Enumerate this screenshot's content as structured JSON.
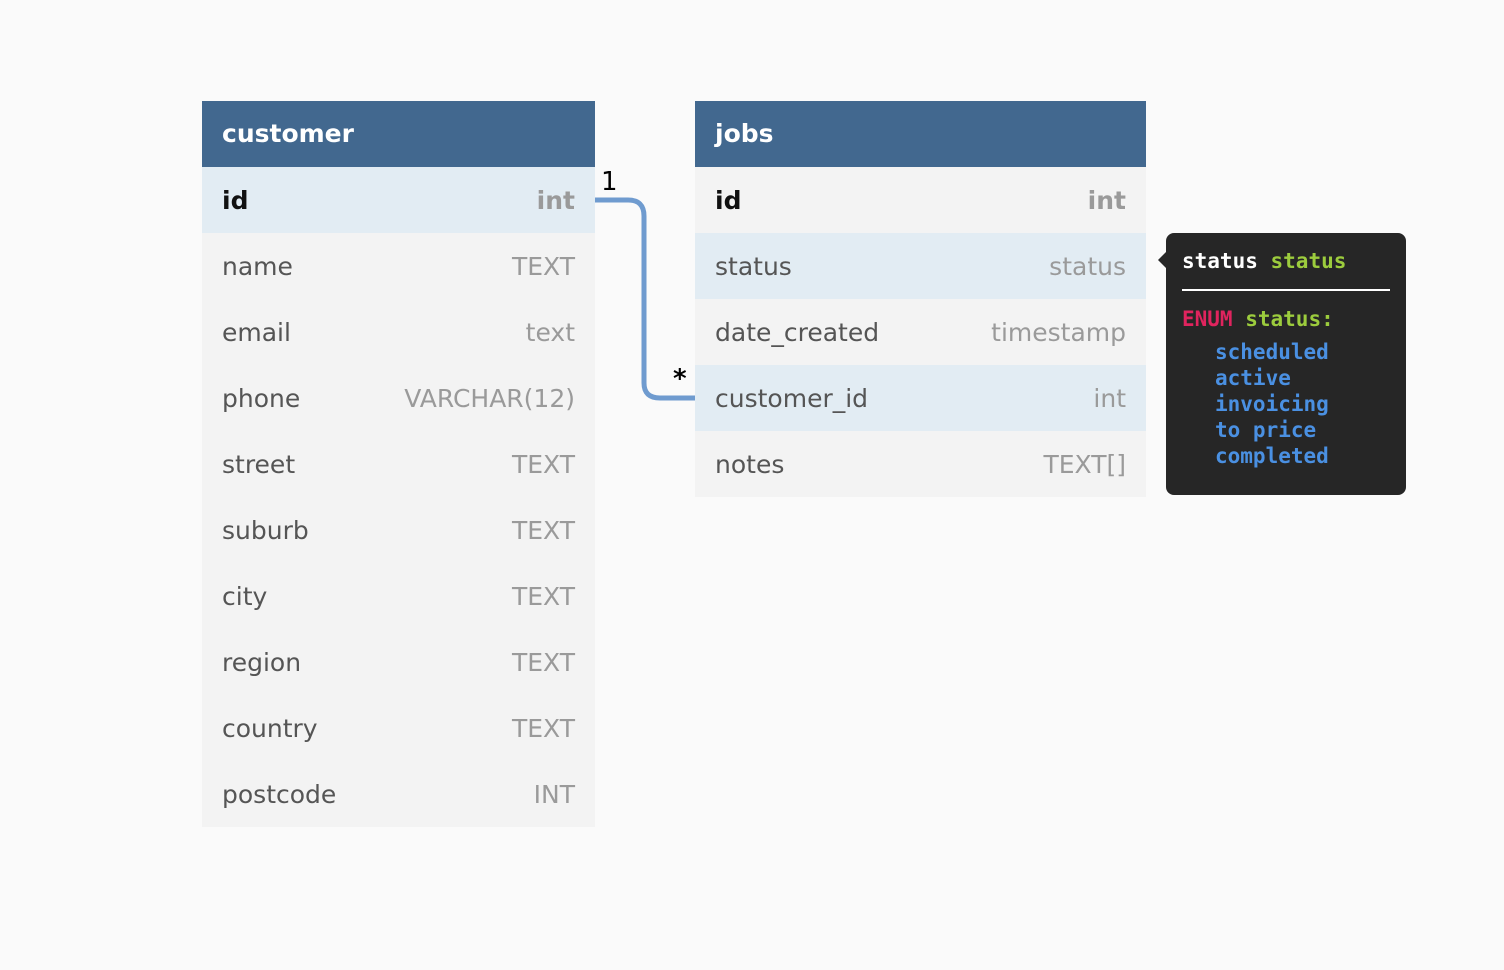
{
  "tables": {
    "customer": {
      "title": "customer",
      "columns": [
        {
          "name": "id",
          "type": "int"
        },
        {
          "name": "name",
          "type": "TEXT"
        },
        {
          "name": "email",
          "type": "text"
        },
        {
          "name": "phone",
          "type": "VARCHAR(12)"
        },
        {
          "name": "street",
          "type": "TEXT"
        },
        {
          "name": "suburb",
          "type": "TEXT"
        },
        {
          "name": "city",
          "type": "TEXT"
        },
        {
          "name": "region",
          "type": "TEXT"
        },
        {
          "name": "country",
          "type": "TEXT"
        },
        {
          "name": "postcode",
          "type": "INT"
        }
      ]
    },
    "jobs": {
      "title": "jobs",
      "columns": [
        {
          "name": "id",
          "type": "int"
        },
        {
          "name": "status",
          "type": "status"
        },
        {
          "name": "date_created",
          "type": "timestamp"
        },
        {
          "name": "customer_id",
          "type": "int"
        },
        {
          "name": "notes",
          "type": "TEXT[]"
        }
      ]
    }
  },
  "relationship": {
    "one_label": "1",
    "many_label": "*"
  },
  "tooltip": {
    "title_name": "status",
    "title_type": "status",
    "enum_keyword": "ENUM",
    "enum_name": "status:",
    "values": [
      "scheduled",
      "active",
      "invoicing",
      "to price",
      "completed"
    ]
  },
  "colors": {
    "header": "#42688f",
    "relation_line": "#6f9bcf",
    "highlight_row": "#e2ecf3",
    "enum_keyword": "#e0245e",
    "enum_name": "#9ccc3d",
    "enum_value": "#4a90e2"
  }
}
